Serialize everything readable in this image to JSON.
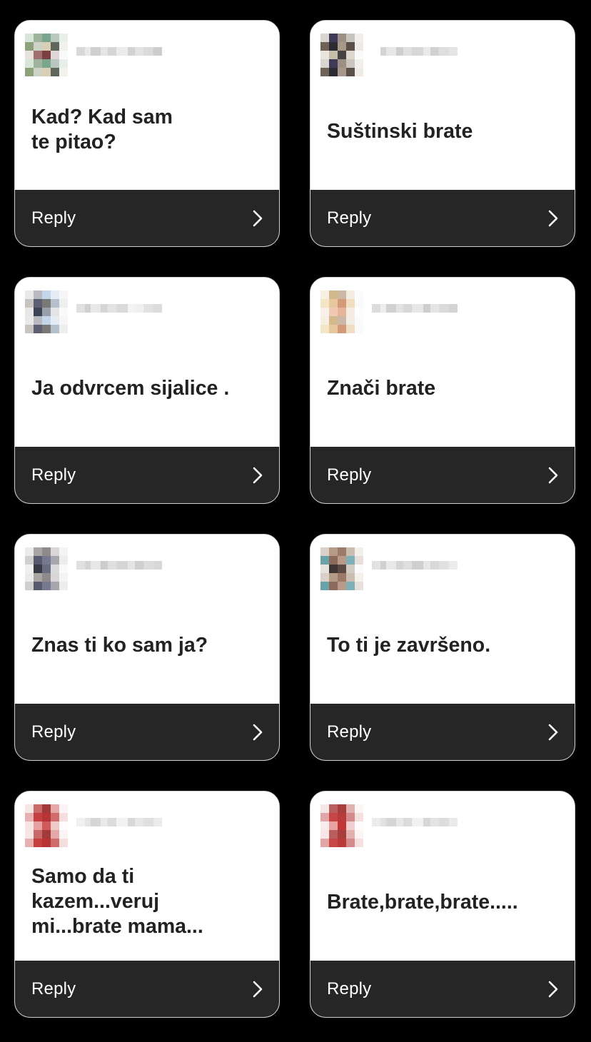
{
  "reply_label": "Reply",
  "cards": [
    {
      "comment": "Kad? Kad sam te pitao?",
      "avatar_colors": [
        "#d8e6da",
        "#9fb49c",
        "#7aa58e",
        "#b9c7bf",
        "#e8eee9",
        "#8ea07c",
        "#cdd3c5",
        "#d9ceb6",
        "#5e665b",
        "#f3f1ec",
        "#e6e2dc",
        "#a06f6f",
        "#7a3f41",
        "#dfd7d6",
        "#fafafa"
      ],
      "username_blocks": [
        "#d8d8d8",
        "#e9e9e9",
        "#cfcfcf",
        "#e4e4e4",
        "#d6d6d6",
        "#ebebeb",
        "#d3d3d3",
        "#e2e2e2",
        "#dadada",
        "#cdcdcd"
      ]
    },
    {
      "comment": "Suštinski brate",
      "avatar_colors": [
        "#d9d6d2",
        "#3e3a58",
        "#9c8f86",
        "#c9c4be",
        "#f1efec",
        "#6e6156",
        "#2c2a33",
        "#a89889",
        "#5b5049",
        "#efeae5",
        "#e8e4de",
        "#c5bca9",
        "#474244",
        "#dcd7cf",
        "#fafafa"
      ],
      "username_blocks": [
        "#ffffff",
        "#d4d4d4",
        "#e6e6e6",
        "#cecece",
        "#e0e0e0",
        "#d7d7d7",
        "#e9e9e9",
        "#d1d1d1",
        "#dedede",
        "#e4e4e4"
      ]
    },
    {
      "comment": "Ja odvrcem sijalice .",
      "avatar_colors": [
        "#e9e9e9",
        "#b8bac0",
        "#c4d6ea",
        "#e6ecf3",
        "#f6f6f6",
        "#c8c4c0",
        "#5c6072",
        "#7b7878",
        "#b6c0cc",
        "#eeeeee",
        "#e7e7e7",
        "#3c4458",
        "#9aa0aa",
        "#e4e4e4",
        "#fafafa"
      ],
      "username_blocks": [
        "#e0e0e0",
        "#d0d0d0",
        "#e8e8e8",
        "#d6d6d6",
        "#e3e3e3",
        "#dadada",
        "#f3f3f3",
        "#f0f0f0",
        "#e2e2e2",
        "#dcdcdc"
      ]
    },
    {
      "comment": "Znači brate",
      "avatar_colors": [
        "#f7f0e2",
        "#d2b98c",
        "#cbb8a6",
        "#f2ece2",
        "#fbfbfb",
        "#f4e5c6",
        "#e6c79e",
        "#d29a7a",
        "#f1dec2",
        "#fafafa",
        "#f8f1ea",
        "#f0c9b4",
        "#e6b49c",
        "#f5ebe3",
        "#fdfdfd"
      ],
      "username_blocks": [
        "#dcdcdc",
        "#eeeeee",
        "#d2d2d2",
        "#e3e3e3",
        "#d8d8d8",
        "#e7e7e7",
        "#cfcfcf",
        "#e5e5e5",
        "#dadada",
        "#d3d3d3"
      ]
    },
    {
      "comment": "Znas ti ko sam ja?",
      "avatar_colors": [
        "#ebebeb",
        "#a9a5a5",
        "#8e8a8c",
        "#d8d6d6",
        "#f4f4f4",
        "#d2cfd0",
        "#5a5a6e",
        "#767a90",
        "#a8a6ad",
        "#ededed",
        "#f0f0f0",
        "#383a46",
        "#6a6c82",
        "#d9d9dd",
        "#fafafa"
      ],
      "username_blocks": [
        "#e0e0e0",
        "#d4d4d4",
        "#e7e7e7",
        "#cccccc",
        "#dfdfdf",
        "#d6d6d6",
        "#e4e4e4",
        "#cfcfcf",
        "#dcdcdc",
        "#d8d8d8"
      ]
    },
    {
      "comment": "To ti je završeno.",
      "avatar_colors": [
        "#d9d0c8",
        "#b59a86",
        "#9c7a6a",
        "#cbbdb2",
        "#f3f0ec",
        "#6aa2aa",
        "#8c6a5c",
        "#b89a8a",
        "#7fb0b8",
        "#e7e0da",
        "#e6e2de",
        "#3e3634",
        "#5c4a44",
        "#d2cac4",
        "#fafafa"
      ],
      "username_blocks": [
        "#e2e2e2",
        "#d0d0d0",
        "#e8e8e8",
        "#d5d5d5",
        "#dedede",
        "#cfcfcf",
        "#e6e6e6",
        "#d8d8d8",
        "#e1e1e1",
        "#ececec"
      ]
    },
    {
      "comment": "Samo da ti kazem...veruj mi...brate mama...",
      "avatar_colors": [
        "#f6e6e6",
        "#c86a6a",
        "#a33a3a",
        "#e5a8a8",
        "#fbf4f4",
        "#e8b0b0",
        "#c43f3f",
        "#b73434",
        "#cf6d6d",
        "#f6dede",
        "#f7e5e5",
        "#e6a0a0",
        "#d05a5a",
        "#efc8c8",
        "#fdfbfb"
      ],
      "username_blocks": [
        "#f0f0f0",
        "#e4e4e4",
        "#d6d6d6",
        "#e9e9e9",
        "#dcdcdc",
        "#f2f2f2",
        "#d8d8d8",
        "#e6e6e6",
        "#dfdfdf",
        "#ebebeb"
      ]
    },
    {
      "comment": "Brate,brate,brate.....",
      "avatar_colors": [
        "#f6e6e6",
        "#b95e5e",
        "#a83d3d",
        "#e3b0b0",
        "#fbf5f5",
        "#e2a6a6",
        "#c84545",
        "#b93a3a",
        "#d48a8a",
        "#f5e0e0",
        "#f8ebeb",
        "#e8a2a2",
        "#c13636",
        "#efcfcf",
        "#fdfbfb"
      ],
      "username_blocks": [
        "#ececec",
        "#e2e2e2",
        "#d6d6d6",
        "#e8e8e8",
        "#dbdbdb",
        "#f1f1f1",
        "#d7d7d7",
        "#e4e4e4",
        "#dddddd",
        "#eaeaea"
      ]
    }
  ]
}
